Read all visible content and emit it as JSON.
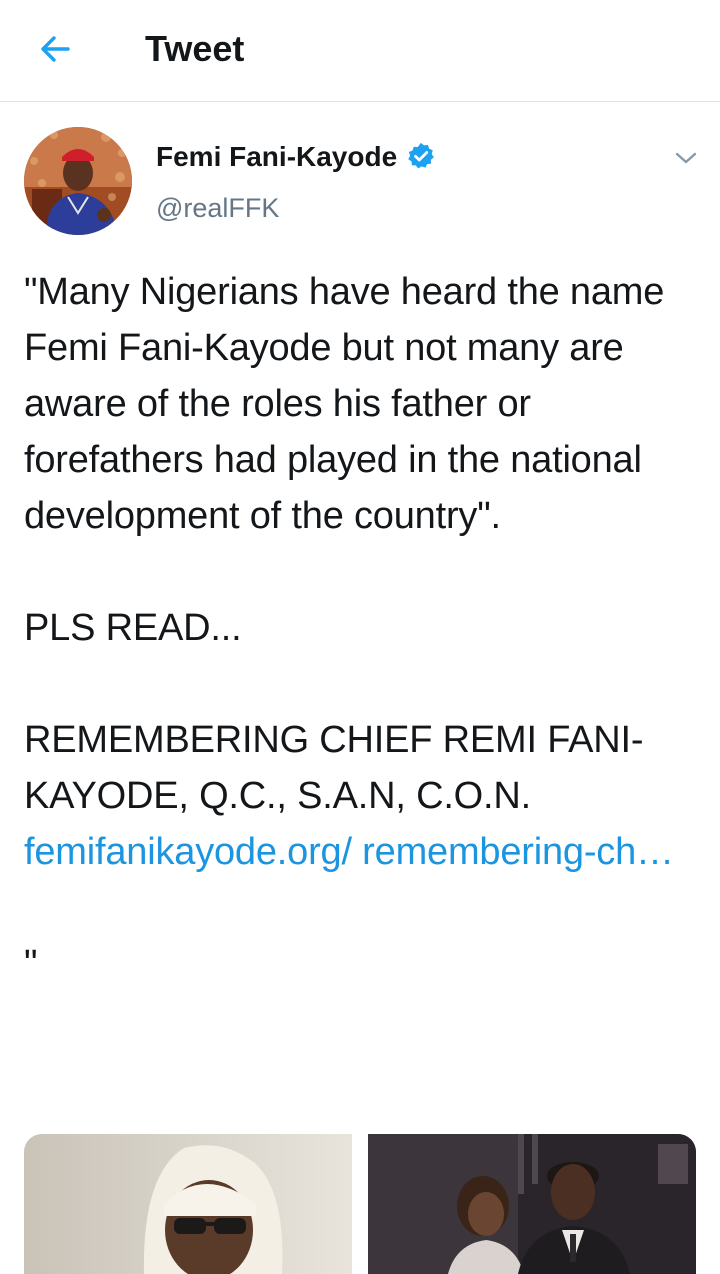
{
  "header": {
    "title": "Tweet",
    "back_icon": "arrow-left-icon"
  },
  "tweet": {
    "author": {
      "display_name": "Femi Fani-Kayode",
      "handle": "@realFFK",
      "verified": true,
      "verified_icon": "verified-badge-icon"
    },
    "text_main": "\"Many Nigerians have heard the name Femi Fani-Kayode but not many are aware of the roles his father or forefathers had played in the national development of the country\".\n\nPLS READ...\n\nREMEMBERING CHIEF REMI FANI-KAYODE, Q.C., S.A.N, C.O.N. ",
    "link_text": "femifanikayode.org/ remembering-ch…",
    "text_after": "\n\n\"",
    "media_count": 2
  },
  "colors": {
    "link": "#1b95e0",
    "accent": "#1da1f2",
    "secondary_text": "#657786",
    "divider": "#dfe3e6"
  }
}
